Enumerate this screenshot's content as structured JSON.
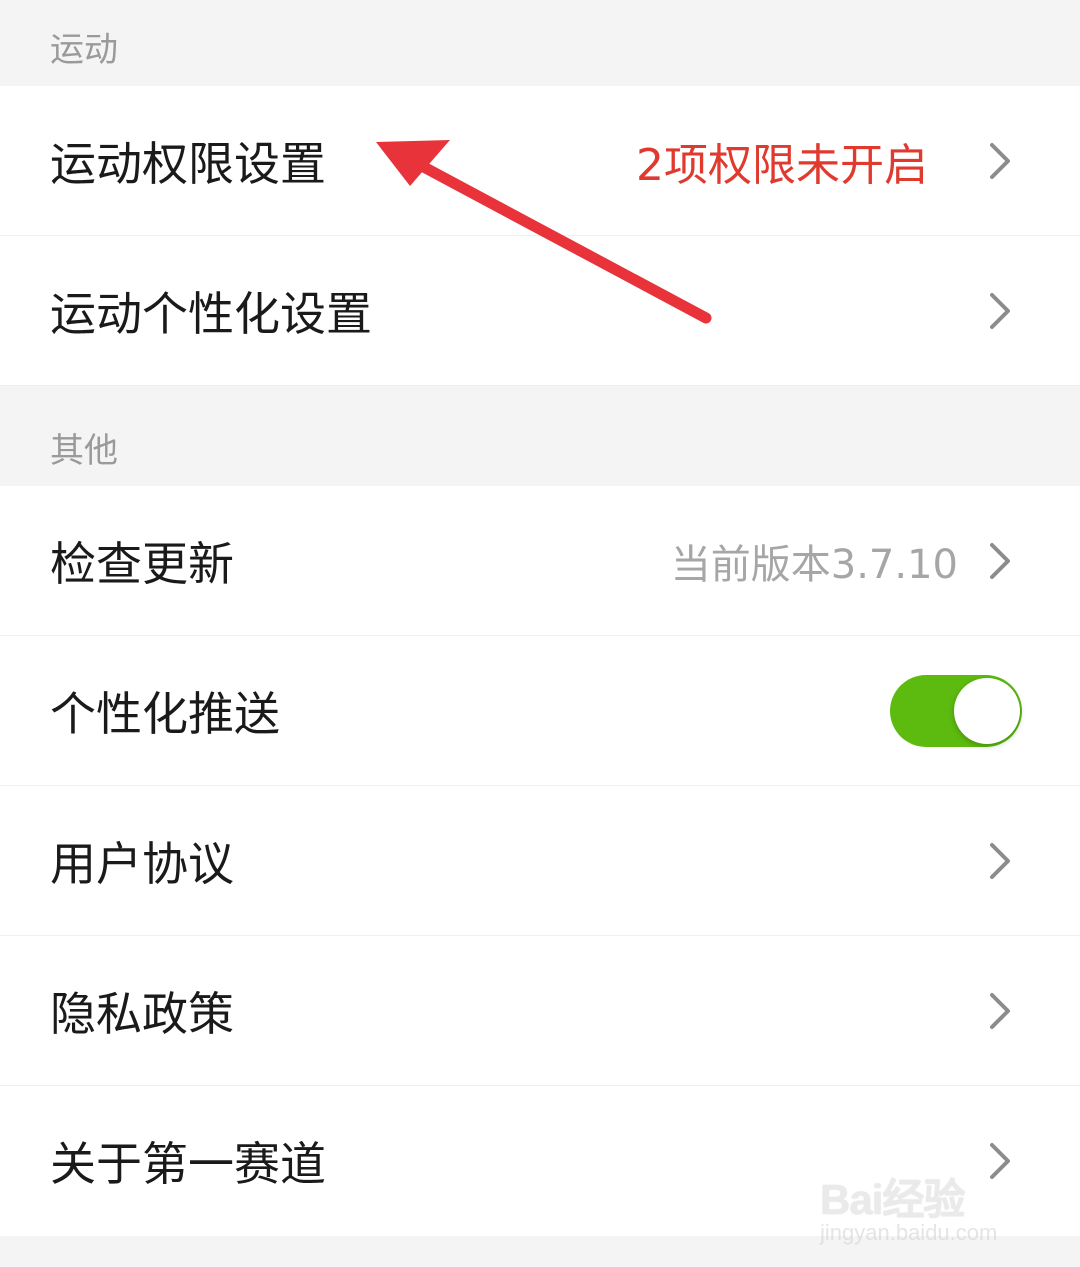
{
  "sections": [
    {
      "header": "运动",
      "items": [
        {
          "label": "运动权限设置",
          "value": "2项权限未开启",
          "value_color": "#e03a2f",
          "control": "chevron"
        },
        {
          "label": "运动个性化设置",
          "value": "",
          "control": "chevron"
        }
      ]
    },
    {
      "header": "其他",
      "items": [
        {
          "label": "检查更新",
          "value": "当前版本3.7.10",
          "control": "chevron"
        },
        {
          "label": "个性化推送",
          "control": "toggle",
          "toggle_on": true
        },
        {
          "label": "用户协议",
          "control": "chevron"
        },
        {
          "label": "隐私政策",
          "control": "chevron"
        },
        {
          "label": "关于第一赛道",
          "control": "chevron"
        }
      ]
    }
  ],
  "annotation": {
    "type": "red-arrow",
    "color": "#e8333a",
    "points_to": "运动权限设置"
  },
  "watermark": {
    "brand": "Bai经验",
    "url": "jingyan.baidu.com"
  },
  "colors": {
    "toggle_on": "#5dbb10",
    "warning": "#e03a2f",
    "background": "#f4f4f4"
  }
}
